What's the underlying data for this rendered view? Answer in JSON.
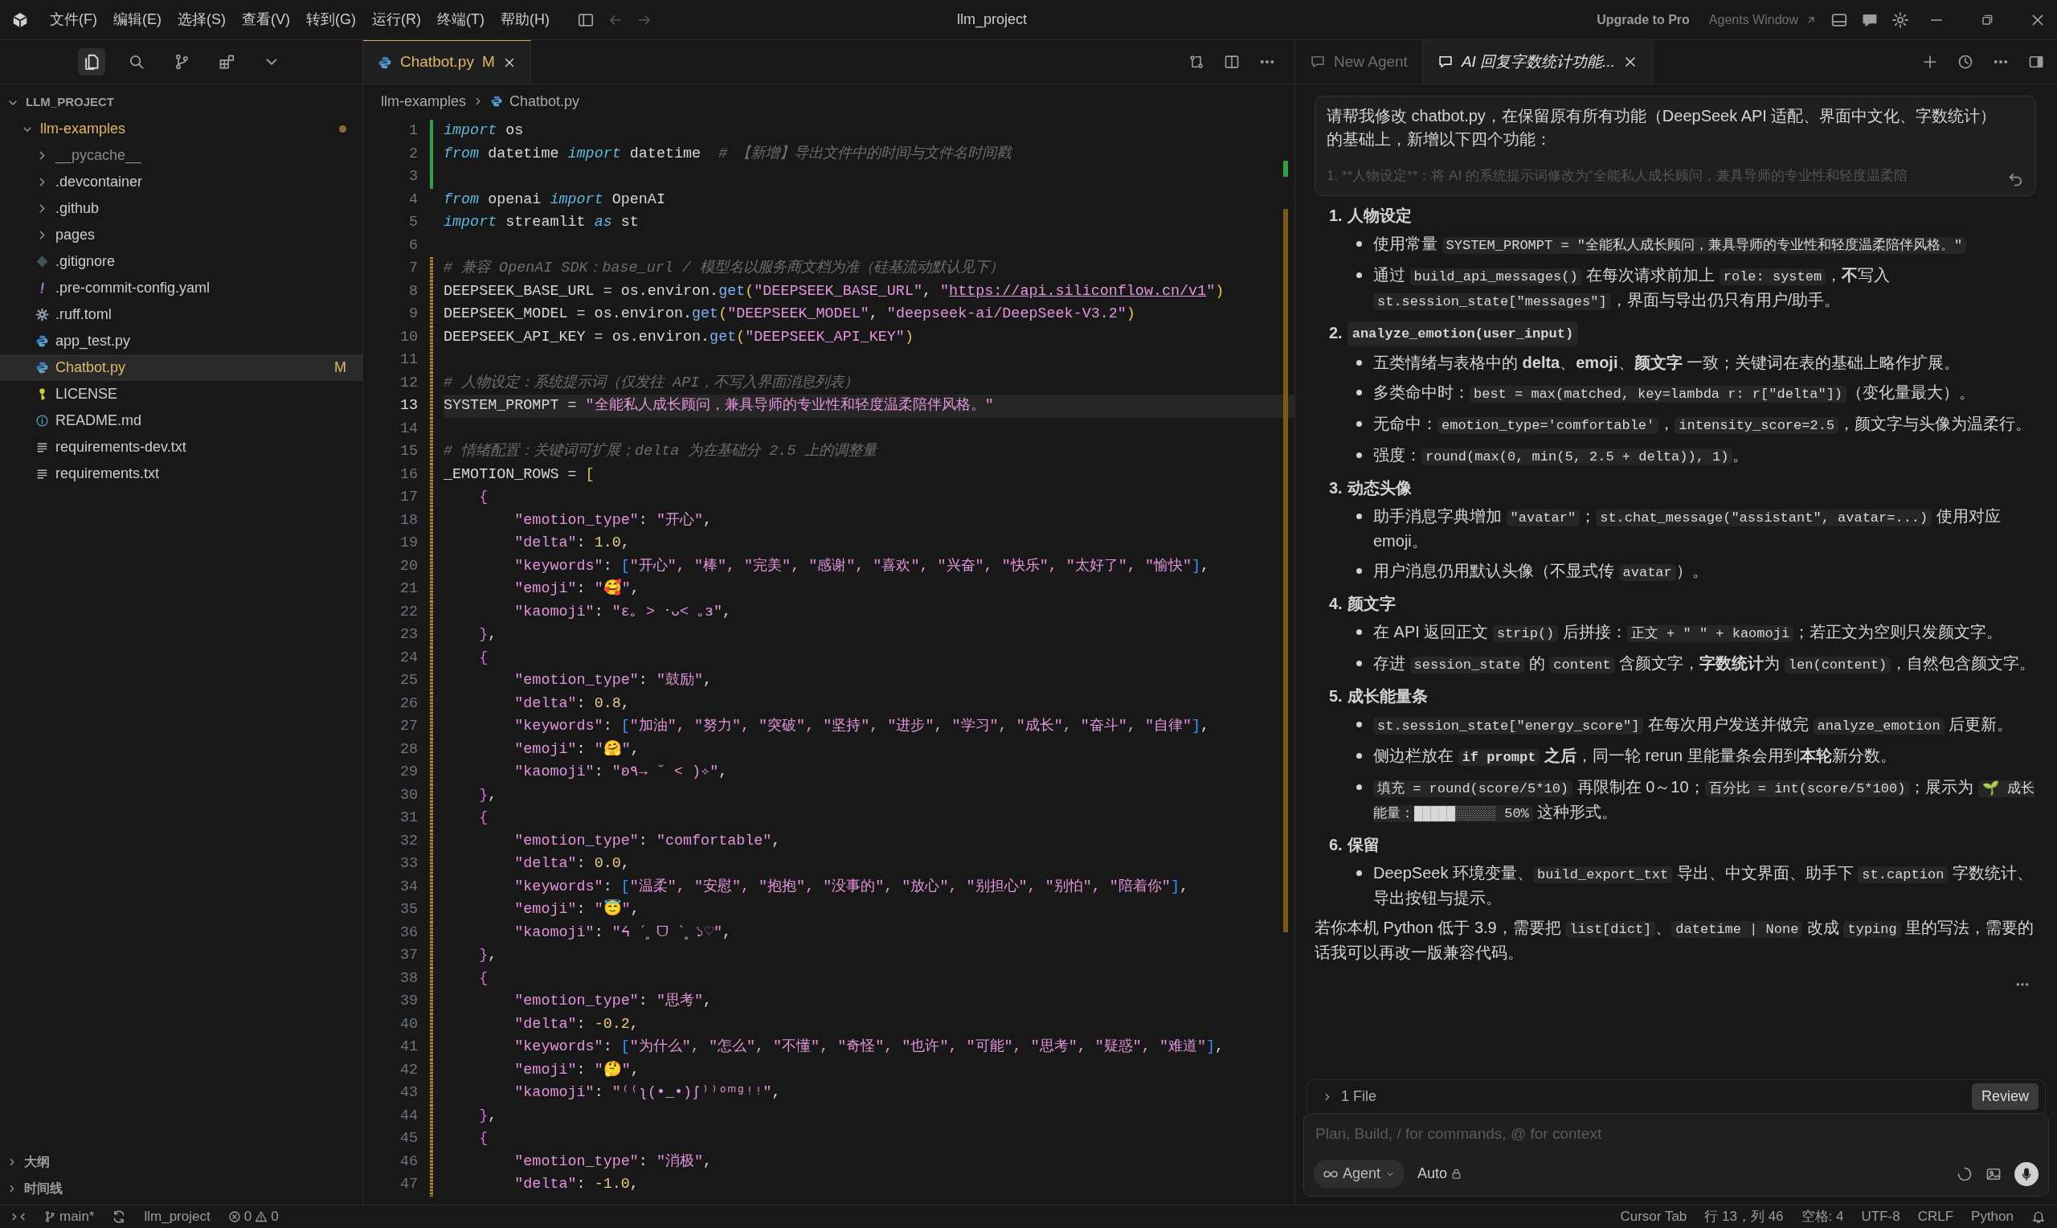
{
  "title_bar": {
    "menus": [
      "文件(F)",
      "编辑(E)",
      "选择(S)",
      "查看(V)",
      "转到(G)",
      "运行(R)",
      "终端(T)",
      "帮助(H)"
    ],
    "title": "llm_project",
    "upgrade": "Upgrade to Pro",
    "agents_window": "Agents Window"
  },
  "explorer": {
    "root": "LLM_PROJECT",
    "root_expanded": true,
    "folder": {
      "name": "llm-examples",
      "expanded": true,
      "modified": true
    },
    "items": [
      {
        "name": "__pycache__",
        "kind": "folder",
        "ignored": true,
        "selected": false
      },
      {
        "name": ".devcontainer",
        "kind": "folder",
        "ignored": false,
        "selected": false
      },
      {
        "name": ".github",
        "kind": "folder",
        "ignored": false,
        "selected": false
      },
      {
        "name": "pages",
        "kind": "folder",
        "ignored": false,
        "selected": false
      },
      {
        "name": ".gitignore",
        "kind": "git",
        "ignored": false,
        "selected": false
      },
      {
        "name": ".pre-commit-config.yaml",
        "kind": "yaml",
        "ignored": false,
        "selected": false
      },
      {
        "name": ".ruff.toml",
        "kind": "config",
        "ignored": false,
        "selected": false
      },
      {
        "name": "app_test.py",
        "kind": "python",
        "ignored": false,
        "selected": false
      },
      {
        "name": "Chatbot.py",
        "kind": "python",
        "ignored": false,
        "selected": true,
        "status": "M"
      },
      {
        "name": "LICENSE",
        "kind": "license",
        "ignored": false,
        "selected": false
      },
      {
        "name": "README.md",
        "kind": "info",
        "ignored": false,
        "selected": false
      },
      {
        "name": "requirements-dev.txt",
        "kind": "text",
        "ignored": false,
        "selected": false
      },
      {
        "name": "requirements.txt",
        "kind": "text",
        "ignored": false,
        "selected": false
      }
    ],
    "sections": [
      {
        "label": "大纲",
        "expanded": false
      },
      {
        "label": "时间线",
        "expanded": false
      }
    ]
  },
  "editor": {
    "tab": {
      "label": "Chatbot.py",
      "status": "M",
      "selected": true
    },
    "breadcrumb": [
      "llm-examples",
      "Chatbot.py"
    ],
    "lines": [
      {
        "number": "1",
        "added": true,
        "modified": false,
        "current": false,
        "tokens": [
          {
            "kind": "kw",
            "text": "import"
          },
          {
            "kind": "plain",
            "text": " os"
          }
        ]
      },
      {
        "number": "2",
        "added": true,
        "modified": false,
        "current": false,
        "tokens": [
          {
            "kind": "kw",
            "text": "from"
          },
          {
            "kind": "plain",
            "text": " datetime "
          },
          {
            "kind": "kw",
            "text": "import"
          },
          {
            "kind": "plain",
            "text": " datetime  "
          },
          {
            "kind": "comment",
            "text": "# 【新增】导出文件中的时间与文件名时间戳"
          }
        ]
      },
      {
        "number": "3",
        "added": true,
        "modified": false,
        "current": false
      },
      {
        "number": "4",
        "added": false,
        "modified": false,
        "current": false,
        "tokens": [
          {
            "kind": "kw",
            "text": "from"
          },
          {
            "kind": "plain",
            "text": " openai "
          },
          {
            "kind": "kw",
            "text": "import"
          },
          {
            "kind": "plain",
            "text": " OpenAI"
          }
        ]
      },
      {
        "number": "5",
        "added": false,
        "modified": false,
        "current": false,
        "tokens": [
          {
            "kind": "kw",
            "text": "import"
          },
          {
            "kind": "plain",
            "text": " streamlit "
          },
          {
            "kind": "kw",
            "text": "as"
          },
          {
            "kind": "plain",
            "text": " st"
          }
        ]
      },
      {
        "number": "6",
        "added": false,
        "modified": false,
        "current": false
      },
      {
        "number": "7",
        "added": false,
        "modified": true,
        "current": false,
        "tokens": [
          {
            "kind": "comment",
            "text": "# 兼容 OpenAI SDK：base_url / 模型名以服务商文档为准（硅基流动默认见下）"
          }
        ]
      },
      {
        "number": "8",
        "added": false,
        "modified": true,
        "current": false,
        "tokens": [
          {
            "kind": "plain",
            "text": "DEEPSEEK_BASE_URL = os.environ."
          },
          {
            "kind": "fn",
            "text": "get"
          },
          {
            "kind": "b1",
            "text": "("
          },
          {
            "kind": "str",
            "text": "\"DEEPSEEK_BASE_URL\""
          },
          {
            "kind": "plain",
            "text": ", "
          },
          {
            "kind": "str",
            "text": "\""
          },
          {
            "kind": "url",
            "text": "https://api.siliconflow.cn/v1"
          },
          {
            "kind": "str",
            "text": "\""
          },
          {
            "kind": "b1",
            "text": ")"
          }
        ]
      },
      {
        "number": "9",
        "added": false,
        "modified": true,
        "current": false,
        "tokens": [
          {
            "kind": "plain",
            "text": "DEEPSEEK_MODEL = os.environ."
          },
          {
            "kind": "fn",
            "text": "get"
          },
          {
            "kind": "b1",
            "text": "("
          },
          {
            "kind": "str",
            "text": "\"DEEPSEEK_MODEL\""
          },
          {
            "kind": "plain",
            "text": ", "
          },
          {
            "kind": "str",
            "text": "\"deepseek-ai/DeepSeek-V3.2\""
          },
          {
            "kind": "b1",
            "text": ")"
          }
        ]
      },
      {
        "number": "10",
        "added": false,
        "modified": true,
        "current": false,
        "tokens": [
          {
            "kind": "plain",
            "text": "DEEPSEEK_API_KEY = os.environ."
          },
          {
            "kind": "fn",
            "text": "get"
          },
          {
            "kind": "b1",
            "text": "("
          },
          {
            "kind": "str",
            "text": "\"DEEPSEEK_API_KEY\""
          },
          {
            "kind": "b1",
            "text": ")"
          }
        ]
      },
      {
        "number": "11",
        "added": false,
        "modified": true,
        "current": false
      },
      {
        "number": "12",
        "added": false,
        "modified": true,
        "current": false,
        "tokens": [
          {
            "kind": "comment",
            "text": "# 人物设定：系统提示词（仅发往 API，不写入界面消息列表）"
          }
        ]
      },
      {
        "number": "13",
        "added": false,
        "modified": true,
        "current": true,
        "tokens": [
          {
            "kind": "plain",
            "text": "SYSTEM_PROMPT = "
          },
          {
            "kind": "str",
            "text": "\"全能私人成长顾问，兼具导师的专业性和轻度温柔陪伴风格。\""
          }
        ]
      },
      {
        "number": "14",
        "added": false,
        "modified": true,
        "current": false
      },
      {
        "number": "15",
        "added": false,
        "modified": true,
        "current": false,
        "tokens": [
          {
            "kind": "comment",
            "text": "# 情绪配置：关键词可扩展；delta 为在基础分 2.5 上的调整量"
          }
        ]
      },
      {
        "number": "16",
        "added": false,
        "modified": true,
        "current": false,
        "tokens": [
          {
            "kind": "plain",
            "text": "_EMOTION_ROWS = "
          },
          {
            "kind": "b1",
            "text": "["
          }
        ]
      },
      {
        "number": "17",
        "added": false,
        "modified": true,
        "current": false,
        "tokens": [
          {
            "kind": "b2",
            "text": "    {"
          }
        ]
      },
      {
        "number": "18",
        "added": false,
        "modified": true,
        "current": false,
        "tokens": [
          {
            "kind": "str",
            "text": "        \"emotion_type\""
          },
          {
            "kind": "plain",
            "text": ": "
          },
          {
            "kind": "str",
            "text": "\"开心\""
          },
          {
            "kind": "plain",
            "text": ","
          }
        ]
      },
      {
        "number": "19",
        "added": false,
        "modified": true,
        "current": false,
        "tokens": [
          {
            "kind": "str",
            "text": "        \"delta\""
          },
          {
            "kind": "plain",
            "text": ": "
          },
          {
            "kind": "num",
            "text": "1.0"
          },
          {
            "kind": "plain",
            "text": ","
          }
        ]
      },
      {
        "number": "20",
        "added": false,
        "modified": true,
        "current": false,
        "tokens": [
          {
            "kind": "str",
            "text": "        \"keywords\""
          },
          {
            "kind": "plain",
            "text": ": "
          },
          {
            "kind": "b3",
            "text": "["
          },
          {
            "kind": "str",
            "text": "\"开心\", \"棒\", \"完美\", \"感谢\", \"喜欢\", \"兴奋\", \"快乐\", \"太好了\", \"愉快\""
          },
          {
            "kind": "b3",
            "text": "]"
          },
          {
            "kind": "plain",
            "text": ","
          }
        ]
      },
      {
        "number": "21",
        "added": false,
        "modified": true,
        "current": false,
        "tokens": [
          {
            "kind": "str",
            "text": "        \"emoji\""
          },
          {
            "kind": "plain",
            "text": ": "
          },
          {
            "kind": "str",
            "text": "\"🥰\""
          },
          {
            "kind": "plain",
            "text": ","
          }
        ]
      },
      {
        "number": "22",
        "added": false,
        "modified": true,
        "current": false,
        "tokens": [
          {
            "kind": "str",
            "text": "        \"kaomoji\""
          },
          {
            "kind": "plain",
            "text": ": "
          },
          {
            "kind": "str",
            "text": "\"ε｡ ˃ ･ᴗ˂ ｡з\""
          },
          {
            "kind": "plain",
            "text": ","
          }
        ]
      },
      {
        "number": "23",
        "added": false,
        "modified": true,
        "current": false,
        "tokens": [
          {
            "kind": "b2",
            "text": "    }"
          },
          {
            "kind": "plain",
            "text": ","
          }
        ]
      },
      {
        "number": "24",
        "added": false,
        "modified": true,
        "current": false,
        "tokens": [
          {
            "kind": "b2",
            "text": "    {"
          }
        ]
      },
      {
        "number": "25",
        "added": false,
        "modified": true,
        "current": false,
        "tokens": [
          {
            "kind": "str",
            "text": "        \"emotion_type\""
          },
          {
            "kind": "plain",
            "text": ": "
          },
          {
            "kind": "str",
            "text": "\"鼓励\""
          },
          {
            "kind": "plain",
            "text": ","
          }
        ]
      },
      {
        "number": "26",
        "added": false,
        "modified": true,
        "current": false,
        "tokens": [
          {
            "kind": "str",
            "text": "        \"delta\""
          },
          {
            "kind": "plain",
            "text": ": "
          },
          {
            "kind": "num",
            "text": "0.8"
          },
          {
            "kind": "plain",
            "text": ","
          }
        ]
      },
      {
        "number": "27",
        "added": false,
        "modified": true,
        "current": false,
        "tokens": [
          {
            "kind": "str",
            "text": "        \"keywords\""
          },
          {
            "kind": "plain",
            "text": ": "
          },
          {
            "kind": "b3",
            "text": "["
          },
          {
            "kind": "str",
            "text": "\"加油\", \"努力\", \"突破\", \"坚持\", \"进步\", \"学习\", \"成长\", \"奋斗\", \"自律\""
          },
          {
            "kind": "b3",
            "text": "]"
          },
          {
            "kind": "plain",
            "text": ","
          }
        ]
      },
      {
        "number": "28",
        "added": false,
        "modified": true,
        "current": false,
        "tokens": [
          {
            "kind": "str",
            "text": "        \"emoji\""
          },
          {
            "kind": "plain",
            "text": ": "
          },
          {
            "kind": "str",
            "text": "\"🤗\""
          },
          {
            "kind": "plain",
            "text": ","
          }
        ]
      },
      {
        "number": "29",
        "added": false,
        "modified": true,
        "current": false,
        "tokens": [
          {
            "kind": "str",
            "text": "        \"kaomoji\""
          },
          {
            "kind": "plain",
            "text": ": "
          },
          {
            "kind": "str",
            "text": "\"ʚ٩→ ˘ ˂ )✧\""
          },
          {
            "kind": "plain",
            "text": ","
          }
        ]
      },
      {
        "number": "30",
        "added": false,
        "modified": true,
        "current": false,
        "tokens": [
          {
            "kind": "b2",
            "text": "    }"
          },
          {
            "kind": "plain",
            "text": ","
          }
        ]
      },
      {
        "number": "31",
        "added": false,
        "modified": true,
        "current": false,
        "tokens": [
          {
            "kind": "b2",
            "text": "    {"
          }
        ]
      },
      {
        "number": "32",
        "added": false,
        "modified": true,
        "current": false,
        "tokens": [
          {
            "kind": "str",
            "text": "        \"emotion_type\""
          },
          {
            "kind": "plain",
            "text": ": "
          },
          {
            "kind": "str",
            "text": "\"comfortable\""
          },
          {
            "kind": "plain",
            "text": ","
          }
        ]
      },
      {
        "number": "33",
        "added": false,
        "modified": true,
        "current": false,
        "tokens": [
          {
            "kind": "str",
            "text": "        \"delta\""
          },
          {
            "kind": "plain",
            "text": ": "
          },
          {
            "kind": "num",
            "text": "0.0"
          },
          {
            "kind": "plain",
            "text": ","
          }
        ]
      },
      {
        "number": "34",
        "added": false,
        "modified": true,
        "current": false,
        "tokens": [
          {
            "kind": "str",
            "text": "        \"keywords\""
          },
          {
            "kind": "plain",
            "text": ": "
          },
          {
            "kind": "b3",
            "text": "["
          },
          {
            "kind": "str",
            "text": "\"温柔\", \"安慰\", \"抱抱\", \"没事的\", \"放心\", \"别担心\", \"别怕\", \"陪着你\""
          },
          {
            "kind": "b3",
            "text": "]"
          },
          {
            "kind": "plain",
            "text": ","
          }
        ]
      },
      {
        "number": "35",
        "added": false,
        "modified": true,
        "current": false,
        "tokens": [
          {
            "kind": "str",
            "text": "        \"emoji\""
          },
          {
            "kind": "plain",
            "text": ": "
          },
          {
            "kind": "str",
            "text": "\"😇\""
          },
          {
            "kind": "plain",
            "text": ","
          }
        ]
      },
      {
        "number": "36",
        "added": false,
        "modified": true,
        "current": false,
        "tokens": [
          {
            "kind": "str",
            "text": "        \"kaomoji\""
          },
          {
            "kind": "plain",
            "text": ": "
          },
          {
            "kind": "str",
            "text": "\"ᔦ ˊ͈ ᗜ ˋ͈ ১♡\""
          },
          {
            "kind": "plain",
            "text": ","
          }
        ]
      },
      {
        "number": "37",
        "added": false,
        "modified": true,
        "current": false,
        "tokens": [
          {
            "kind": "b2",
            "text": "    }"
          },
          {
            "kind": "plain",
            "text": ","
          }
        ]
      },
      {
        "number": "38",
        "added": false,
        "modified": true,
        "current": false,
        "tokens": [
          {
            "kind": "b2",
            "text": "    {"
          }
        ]
      },
      {
        "number": "39",
        "added": false,
        "modified": true,
        "current": false,
        "tokens": [
          {
            "kind": "str",
            "text": "        \"emotion_type\""
          },
          {
            "kind": "plain",
            "text": ": "
          },
          {
            "kind": "str",
            "text": "\"思考\""
          },
          {
            "kind": "plain",
            "text": ","
          }
        ]
      },
      {
        "number": "40",
        "added": false,
        "modified": true,
        "current": false,
        "tokens": [
          {
            "kind": "str",
            "text": "        \"delta\""
          },
          {
            "kind": "plain",
            "text": ": "
          },
          {
            "kind": "num",
            "text": "-0.2"
          },
          {
            "kind": "plain",
            "text": ","
          }
        ]
      },
      {
        "number": "41",
        "added": false,
        "modified": true,
        "current": false,
        "tokens": [
          {
            "kind": "str",
            "text": "        \"keywords\""
          },
          {
            "kind": "plain",
            "text": ": "
          },
          {
            "kind": "b3",
            "text": "["
          },
          {
            "kind": "str",
            "text": "\"为什么\", \"怎么\", \"不懂\", \"奇怪\", \"也许\", \"可能\", \"思考\", \"疑惑\", \"难道\""
          },
          {
            "kind": "b3",
            "text": "]"
          },
          {
            "kind": "plain",
            "text": ","
          }
        ]
      },
      {
        "number": "42",
        "added": false,
        "modified": true,
        "current": false,
        "tokens": [
          {
            "kind": "str",
            "text": "        \"emoji\""
          },
          {
            "kind": "plain",
            "text": ": "
          },
          {
            "kind": "str",
            "text": "\"🤔\""
          },
          {
            "kind": "plain",
            "text": ","
          }
        ]
      },
      {
        "number": "43",
        "added": false,
        "modified": true,
        "current": false,
        "tokens": [
          {
            "kind": "str",
            "text": "        \"kaomoji\""
          },
          {
            "kind": "plain",
            "text": ": "
          },
          {
            "kind": "str",
            "text": "\"⁽⁽ʅ(•_•)ʃ⁾⁾ᵒᵐᵍᵎᵎ\""
          },
          {
            "kind": "plain",
            "text": ","
          }
        ]
      },
      {
        "number": "44",
        "added": false,
        "modified": true,
        "current": false,
        "tokens": [
          {
            "kind": "b2",
            "text": "    }"
          },
          {
            "kind": "plain",
            "text": ","
          }
        ]
      },
      {
        "number": "45",
        "added": false,
        "modified": true,
        "current": false,
        "tokens": [
          {
            "kind": "b2",
            "text": "    {"
          }
        ]
      },
      {
        "number": "46",
        "added": false,
        "modified": true,
        "current": false,
        "tokens": [
          {
            "kind": "str",
            "text": "        \"emotion_type\""
          },
          {
            "kind": "plain",
            "text": ": "
          },
          {
            "kind": "str",
            "text": "\"消极\""
          },
          {
            "kind": "plain",
            "text": ","
          }
        ]
      },
      {
        "number": "47",
        "added": false,
        "modified": true,
        "current": false,
        "tokens": [
          {
            "kind": "str",
            "text": "        \"delta\""
          },
          {
            "kind": "plain",
            "text": ": "
          },
          {
            "kind": "num",
            "text": "-1.0"
          },
          {
            "kind": "plain",
            "text": ","
          }
        ]
      }
    ]
  },
  "agent_panel": {
    "tabs": [
      {
        "label": "New Agent",
        "selected": false
      },
      {
        "label": "AI 回复字数统计功能...",
        "selected": true
      }
    ],
    "prompt": {
      "text": "请帮我修改 chatbot.py，在保留原有所有功能（DeepSeek API 适配、界面中文化、字数统计）的基础上，新增以下四个功能：",
      "faded": "1. **人物设定**：将 AI 的系统提示词修改为“全能私人成长顾问，兼具导师的专业性和轻度温柔陪"
    },
    "sections": [
      {
        "number": "1.",
        "kind": "text",
        "title": "人物设定",
        "bullets": [
          [
            {
              "kind": "text",
              "text": "使用常量 "
            },
            {
              "kind": "code",
              "text": "SYSTEM_PROMPT = \"全能私人成长顾问，兼具导师的专业性和轻度温柔陪伴风格。\""
            }
          ],
          [
            {
              "kind": "text",
              "text": "通过 "
            },
            {
              "kind": "code",
              "text": "build_api_messages()"
            },
            {
              "kind": "text",
              "text": " 在每次请求前加上 "
            },
            {
              "kind": "code",
              "text": "role: system"
            },
            {
              "kind": "text",
              "text": "，**不**写入 "
            },
            {
              "kind": "code",
              "text": "st.session_state[\"messages\"]"
            },
            {
              "kind": "text",
              "text": "，界面与导出仍只有用户/助手。"
            }
          ]
        ]
      },
      {
        "number": "2.",
        "kind": "code",
        "title": "analyze_emotion(user_input)",
        "bullets": [
          [
            {
              "kind": "text",
              "text": "五类情绪与表格中的 **delta**、**emoji**、**颜文字** 一致；关键词在表的基础上略作扩展。"
            }
          ],
          [
            {
              "kind": "text",
              "text": "多类命中时："
            },
            {
              "kind": "code",
              "text": "best = max(matched, key=lambda r: r[\"delta\"])"
            },
            {
              "kind": "text",
              "text": "（变化量最大）。"
            }
          ],
          [
            {
              "kind": "text",
              "text": "无命中："
            },
            {
              "kind": "code",
              "text": "emotion_type='comfortable'"
            },
            {
              "kind": "text",
              "text": "，"
            },
            {
              "kind": "code",
              "text": "intensity_score=2.5"
            },
            {
              "kind": "text",
              "text": "，颜文字与头像为温柔行。"
            }
          ],
          [
            {
              "kind": "text",
              "text": "强度："
            },
            {
              "kind": "code",
              "text": "round(max(0, min(5, 2.5 + delta)), 1)"
            },
            {
              "kind": "text",
              "text": "。"
            }
          ]
        ]
      },
      {
        "number": "3.",
        "kind": "text",
        "title": "动态头像",
        "bullets": [
          [
            {
              "kind": "text",
              "text": "助手消息字典增加 "
            },
            {
              "kind": "code",
              "text": "\"avatar\""
            },
            {
              "kind": "text",
              "text": "；"
            },
            {
              "kind": "code",
              "text": "st.chat_message(\"assistant\", avatar=...)"
            },
            {
              "kind": "text",
              "text": " 使用对应 emoji。"
            }
          ],
          [
            {
              "kind": "text",
              "text": "用户消息仍用默认头像（不显式传 "
            },
            {
              "kind": "code",
              "text": "avatar"
            },
            {
              "kind": "text",
              "text": "）。"
            }
          ]
        ]
      },
      {
        "number": "4.",
        "kind": "text",
        "title": "颜文字",
        "bullets": [
          [
            {
              "kind": "text",
              "text": "在 API 返回正文 "
            },
            {
              "kind": "code",
              "text": "strip()"
            },
            {
              "kind": "text",
              "text": " 后拼接："
            },
            {
              "kind": "code",
              "text": "正文 + \" \" + kaomoji"
            },
            {
              "kind": "text",
              "text": "；若正文为空则只发颜文字。"
            }
          ],
          [
            {
              "kind": "text",
              "text": "存进 "
            },
            {
              "kind": "code",
              "text": "session_state"
            },
            {
              "kind": "text",
              "text": " 的 "
            },
            {
              "kind": "code",
              "text": "content"
            },
            {
              "kind": "text",
              "text": " 含颜文字，**字数统计**为 "
            },
            {
              "kind": "code",
              "text": "len(content)"
            },
            {
              "kind": "text",
              "text": "，自然包含颜文字。"
            }
          ]
        ]
      },
      {
        "number": "5.",
        "kind": "text",
        "title": "成长能量条",
        "bullets": [
          [
            {
              "kind": "code",
              "text": "st.session_state[\"energy_score\"]"
            },
            {
              "kind": "text",
              "text": " 在每次用户发送并做完 "
            },
            {
              "kind": "code",
              "text": "analyze_emotion"
            },
            {
              "kind": "text",
              "text": " 后更新。"
            }
          ],
          [
            {
              "kind": "text",
              "text": "侧边栏放在 "
            },
            {
              "kind": "code",
              "text": "**if prompt**"
            },
            {
              "kind": "text",
              "text": " **之后**，同一轮 rerun 里能量条会用到**本轮**新分数。"
            }
          ],
          [
            {
              "kind": "code",
              "text": "填充 = round(score/5*10)"
            },
            {
              "kind": "text",
              "text": " 再限制在 0～10；"
            },
            {
              "kind": "code",
              "text": "百分比 = int(score/5*100)"
            },
            {
              "kind": "text",
              "text": "；展示为 "
            },
            {
              "kind": "code",
              "text": "🌱 成长能量：█████░░░░░ 50%"
            },
            {
              "kind": "text",
              "text": " 这种形式。"
            }
          ]
        ]
      },
      {
        "number": "6.",
        "kind": "text",
        "title": "保留",
        "bullets": [
          [
            {
              "kind": "text",
              "text": "DeepSeek 环境变量、"
            },
            {
              "kind": "code",
              "text": "build_export_txt"
            },
            {
              "kind": "text",
              "text": " 导出、中文界面、助手下 "
            },
            {
              "kind": "code",
              "text": "st.caption"
            },
            {
              "kind": "text",
              "text": " 字数统计、导出按钮与提示。"
            }
          ]
        ]
      }
    ],
    "closing": [
      {
        "kind": "text",
        "text": "若你本机 Python 低于 3.9，需要把 "
      },
      {
        "kind": "code",
        "text": "list[dict]"
      },
      {
        "kind": "text",
        "text": "、"
      },
      {
        "kind": "code",
        "text": "datetime | None"
      },
      {
        "kind": "text",
        "text": " 改成 "
      },
      {
        "kind": "code",
        "text": "typing"
      },
      {
        "kind": "text",
        "text": " 里的写法，需要的话我可以再改一版兼容代码。"
      }
    ],
    "files_changed": {
      "label": "1 File",
      "expanded": false,
      "action": "Review"
    },
    "composer": {
      "placeholder": "Plan, Build, / for commands, @ for context",
      "mode": "Agent",
      "model": "Auto"
    }
  },
  "status_bar": {
    "branch": "main*",
    "project": "llm_project",
    "errors": "0",
    "warnings": "0",
    "right": [
      "Cursor Tab",
      "行 13，列 46",
      "空格: 4",
      "UTF-8",
      "CRLF",
      "Python"
    ]
  }
}
